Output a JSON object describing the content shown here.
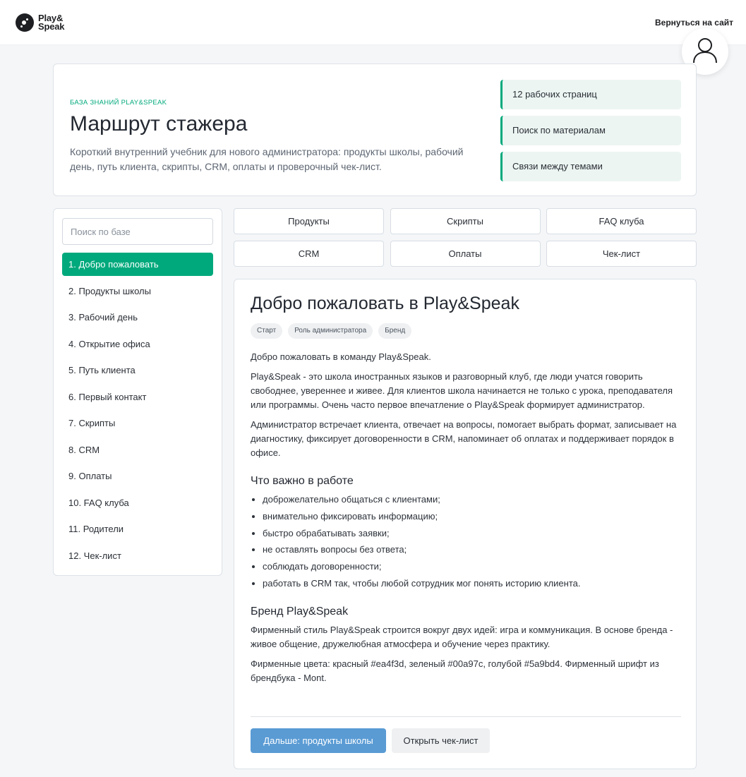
{
  "header": {
    "logo_line1": "Play&",
    "logo_line2": "Speak",
    "back_link": "Вернуться на сайт"
  },
  "hero": {
    "eyebrow": "БАЗА ЗНАНИЙ PLAY&SPEAK",
    "title": "Маршрут стажера",
    "description": "Короткий внутренний учебник для нового администратора: продукты школы, рабочий день, путь клиента, скрипты, CRM, оплаты и проверочный чек-лист.",
    "features": [
      "12 рабочих страниц",
      "Поиск по материалам",
      "Связи между темами"
    ]
  },
  "sidebar": {
    "search_placeholder": "Поиск по базе",
    "items": [
      "1. Добро пожаловать",
      "2. Продукты школы",
      "3. Рабочий день",
      "4. Открытие офиса",
      "5. Путь клиента",
      "6. Первый контакт",
      "7. Скрипты",
      "8. CRM",
      "9. Оплаты",
      "10. FAQ клуба",
      "11. Родители",
      "12. Чек-лист"
    ],
    "active_index": 0
  },
  "tabs": [
    "Продукты",
    "Скрипты",
    "FAQ клуба",
    "CRM",
    "Оплаты",
    "Чек-лист"
  ],
  "content": {
    "title": "Добро пожаловать в Play&Speak",
    "tags": [
      "Старт",
      "Роль администратора",
      "Бренд"
    ],
    "p1": "Добро пожаловать в команду Play&Speak.",
    "p2": "Play&Speak - это школа иностранных языков и разговорный клуб, где люди учатся говорить свободнее, увереннее и живее. Для клиентов школа начинается не только с урока, преподавателя или программы. Очень часто первое впечатление о Play&Speak формирует администратор.",
    "p3": "Администратор встречает клиента, отвечает на вопросы, помогает выбрать формат, записывает на диагностику, фиксирует договоренности в CRM, напоминает об оплатах и поддерживает порядок в офисе.",
    "h_important": "Что важно в работе",
    "list": [
      "доброжелательно общаться с клиентами;",
      "внимательно фиксировать информацию;",
      "быстро обрабатывать заявки;",
      "не оставлять вопросы без ответа;",
      "соблюдать договоренности;",
      "работать в CRM так, чтобы любой сотрудник мог понять историю клиента."
    ],
    "h_brand": "Бренд Play&Speak",
    "p4": "Фирменный стиль Play&Speak строится вокруг двух идей: игра и коммуникация. В основе бренда - живое общение, дружелюбная атмосфера и обучение через практику.",
    "p5": "Фирменные цвета: красный #ea4f3d, зеленый #00a97c, голубой #5a9bd4. Фирменный шрифт из брендбука - Mont.",
    "btn_next": "Дальше: продукты школы",
    "btn_checklist": "Открыть чек-лист"
  },
  "colors": {
    "accent_green": "#00a97c",
    "button_blue": "#5a9bd4"
  },
  "icons": {
    "logo": "play-speak-logo-icon",
    "avatar": "user-avatar-icon"
  }
}
